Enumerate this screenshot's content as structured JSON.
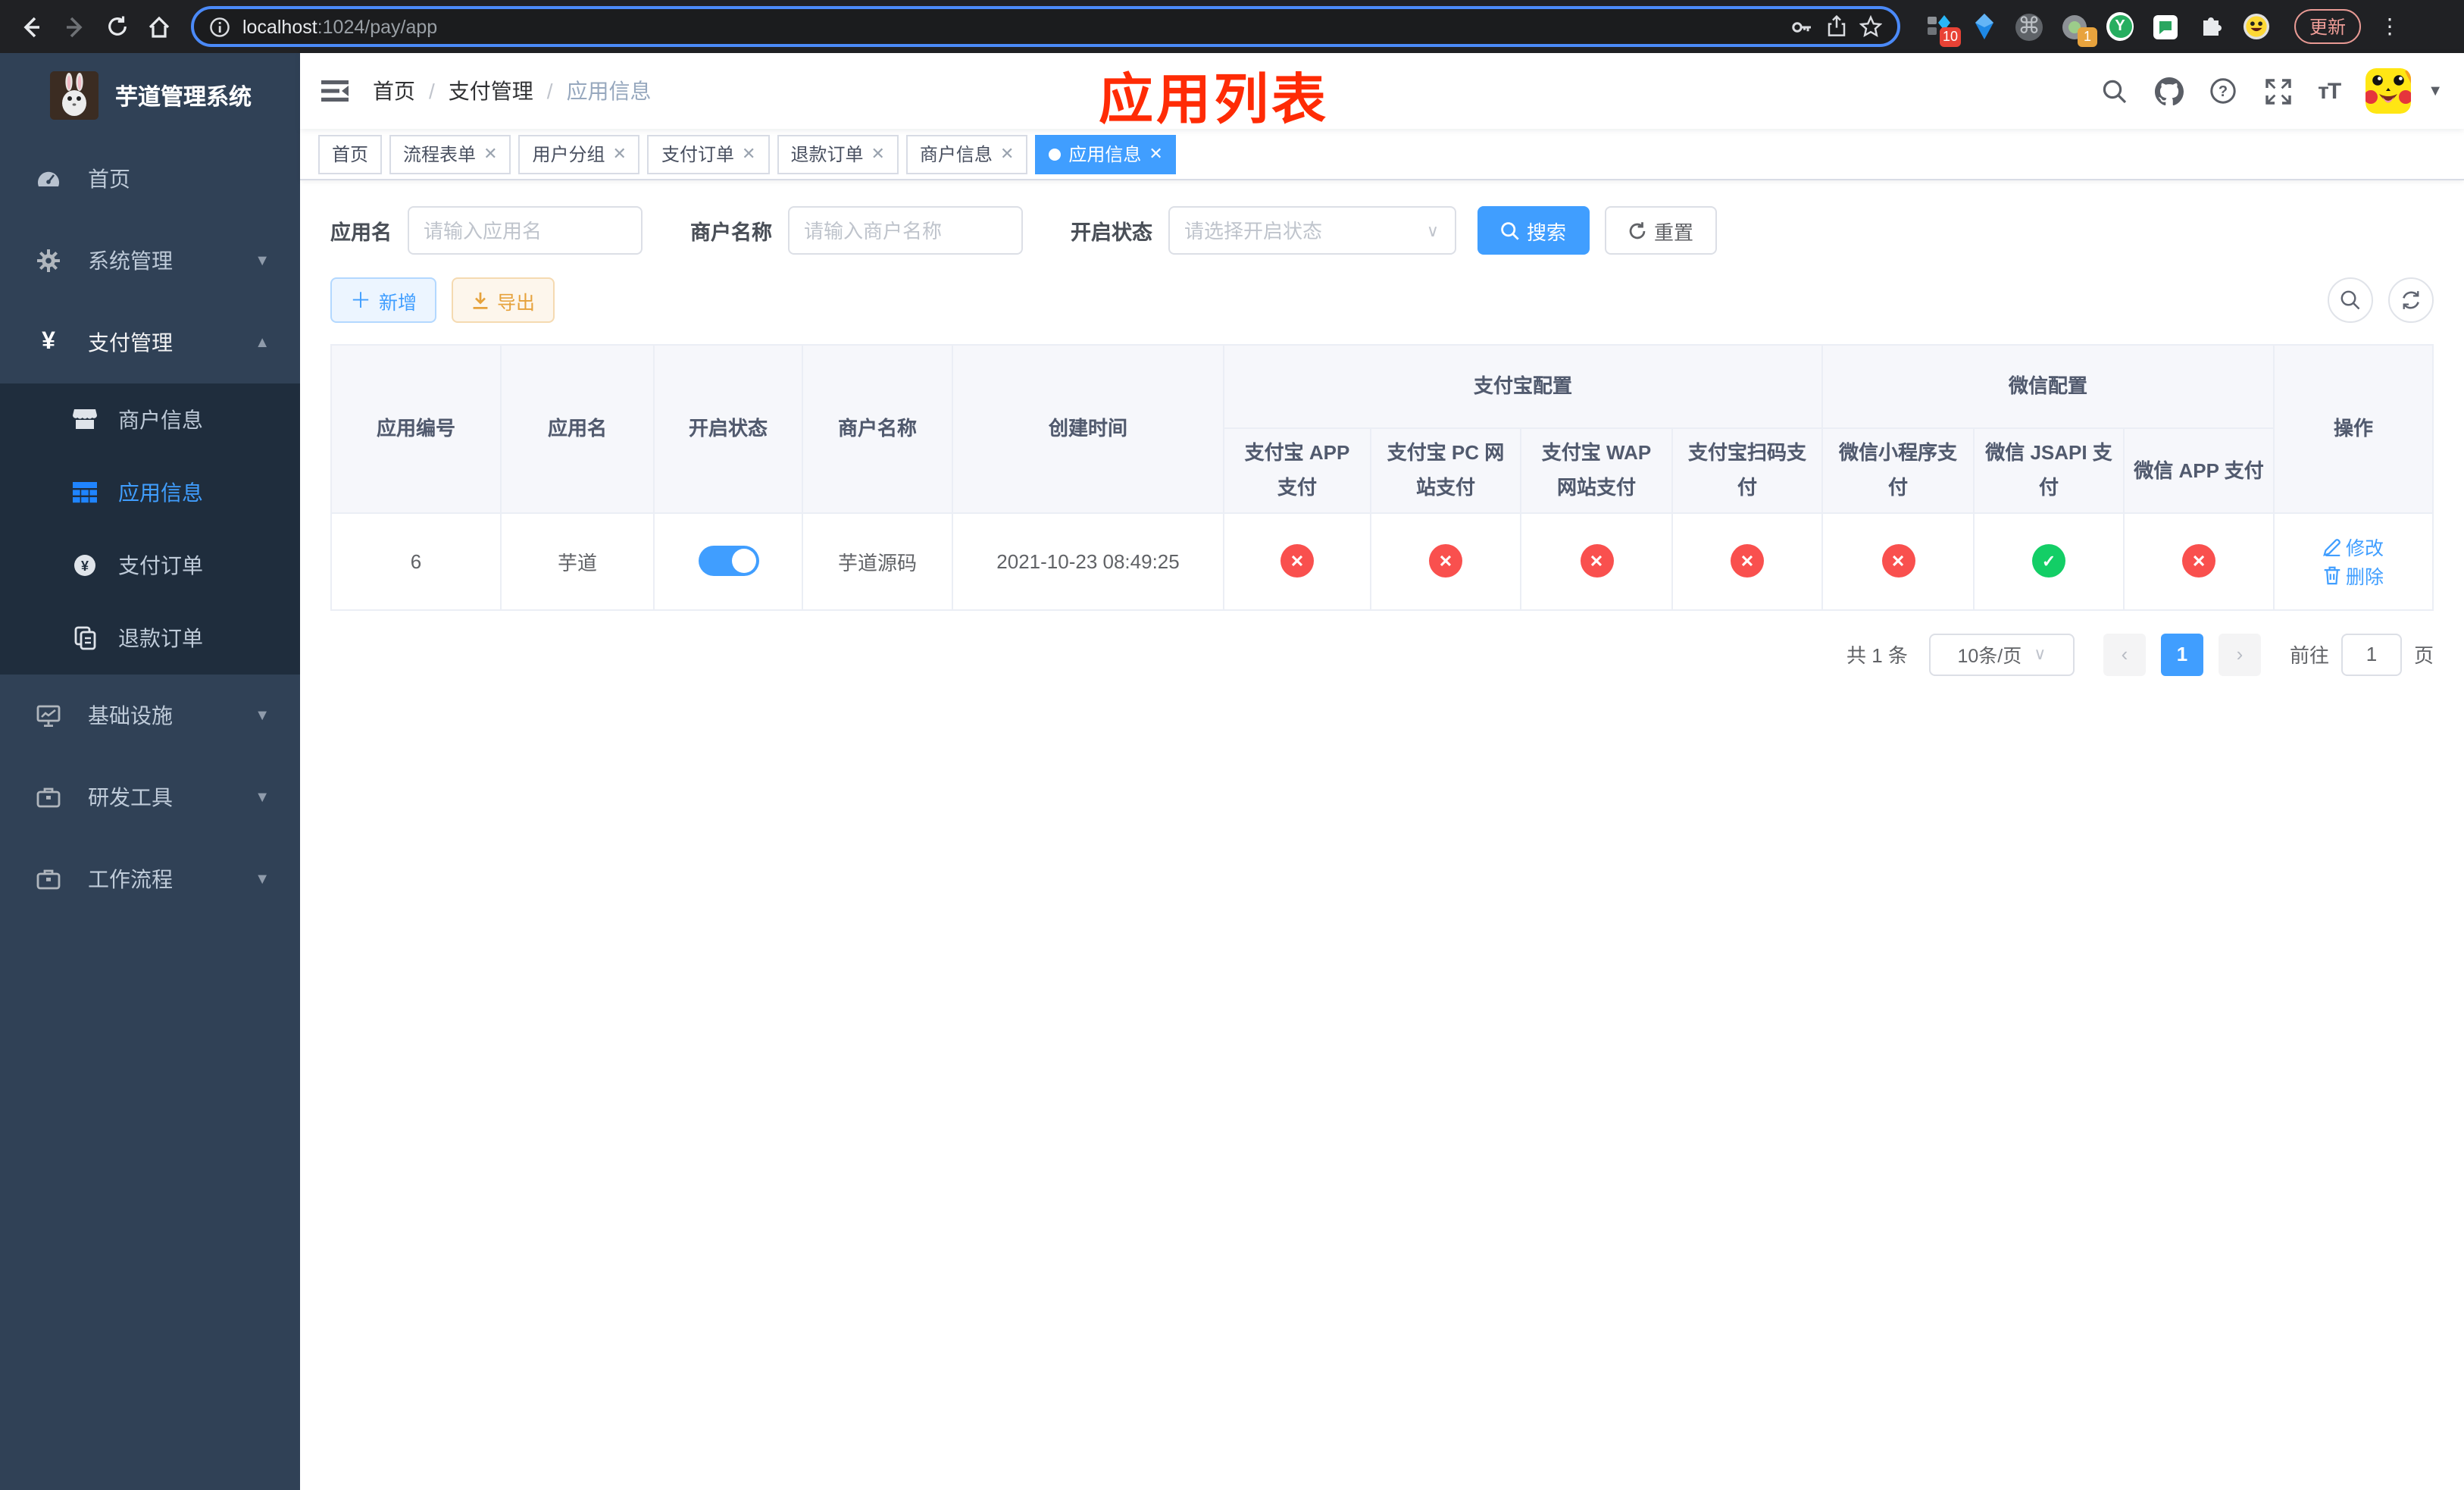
{
  "colors": {
    "primary": "#409eff",
    "success": "#13ce66",
    "danger": "#f9504e",
    "annotation": "#ff2b05",
    "warning": "#e6a23c"
  },
  "browser": {
    "url_host": "localhost",
    "url_rest": ":1024/pay/app",
    "update_label": "更新",
    "ext_badge_10": "10",
    "ext_badge_1": "1",
    "ext_y_letter": "Y",
    "ext_cmd_glyph": "⌘",
    "kebab_glyph": "⋮"
  },
  "sidebar": {
    "title": "芋道管理系统",
    "items": [
      {
        "label": "首页"
      },
      {
        "label": "系统管理"
      },
      {
        "label": "支付管理"
      },
      {
        "label": "商户信息"
      },
      {
        "label": "应用信息"
      },
      {
        "label": "支付订单"
      },
      {
        "label": "退款订单"
      },
      {
        "label": "基础设施"
      },
      {
        "label": "研发工具"
      },
      {
        "label": "工作流程"
      }
    ]
  },
  "breadcrumb": {
    "items": [
      "首页",
      "支付管理",
      "应用信息"
    ],
    "separator": "/"
  },
  "annotation": {
    "title": "应用列表"
  },
  "tabs": [
    {
      "label": "首页",
      "closable": false,
      "active": false
    },
    {
      "label": "流程表单",
      "closable": true,
      "active": false
    },
    {
      "label": "用户分组",
      "closable": true,
      "active": false
    },
    {
      "label": "支付订单",
      "closable": true,
      "active": false
    },
    {
      "label": "退款订单",
      "closable": true,
      "active": false
    },
    {
      "label": "商户信息",
      "closable": true,
      "active": false
    },
    {
      "label": "应用信息",
      "closable": true,
      "active": true
    }
  ],
  "filters": {
    "app_name_label": "应用名",
    "app_name_placeholder": "请输入应用名",
    "merchant_label": "商户名称",
    "merchant_placeholder": "请输入商户名称",
    "status_label": "开启状态",
    "status_placeholder": "请选择开启状态",
    "search_label": "搜索",
    "reset_label": "重置"
  },
  "toolbar": {
    "add_label": "新增",
    "export_label": "导出"
  },
  "table": {
    "headers": {
      "app_id": "应用编号",
      "app_name": "应用名",
      "status": "开启状态",
      "merchant": "商户名称",
      "created": "创建时间",
      "alipay_group": "支付宝配置",
      "wechat_group": "微信配置",
      "sub": [
        "支付宝 APP 支付",
        "支付宝 PC 网站支付",
        "支付宝 WAP 网站支付",
        "支付宝扫码支付",
        "微信小程序支付",
        "微信 JSAPI 支付",
        "微信 APP 支付"
      ],
      "actions": "操作"
    },
    "row": {
      "id": "6",
      "name": "芋道",
      "enabled": true,
      "merchant": "芋道源码",
      "created": "2021-10-23 08:49:25",
      "configs": [
        "no",
        "no",
        "no",
        "no",
        "no",
        "yes",
        "no"
      ],
      "edit_label": "修改",
      "delete_label": "删除"
    }
  },
  "pagination": {
    "total_label": "共 1 条",
    "page_size_label": "10条/页",
    "current_page": "1",
    "goto_label": "前往",
    "goto_value": "1",
    "page_unit": "页"
  }
}
